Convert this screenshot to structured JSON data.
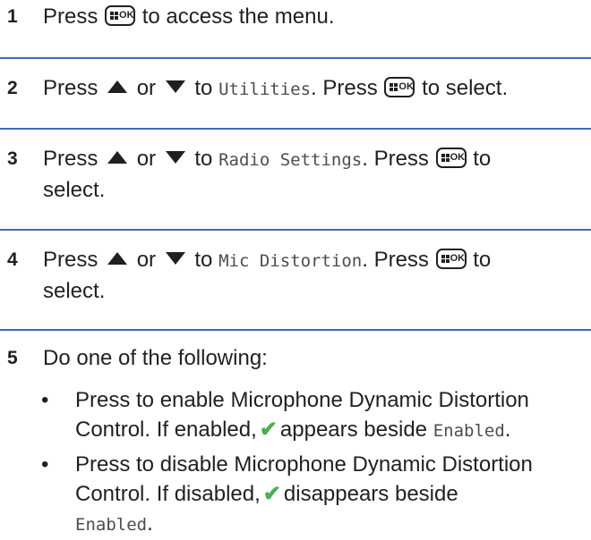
{
  "steps": [
    {
      "num": "1",
      "t1": "Press",
      "t2": "to access the menu."
    },
    {
      "num": "2",
      "t1": "Press",
      "or": "or",
      "to": "to",
      "menu": "Utilities",
      "t3": ". Press",
      "t4": "to select."
    },
    {
      "num": "3",
      "t1": "Press",
      "or": "or",
      "to": "to",
      "menu": "Radio Settings",
      "t3": ". Press",
      "t4": "to",
      "t5": "select."
    },
    {
      "num": "4",
      "t1": "Press",
      "or": "or",
      "to": "to",
      "menu": "Mic Distortion",
      "t3": ". Press",
      "t4": "to",
      "t5": "select."
    },
    {
      "num": "5",
      "text": "Do one of the following:"
    }
  ],
  "bullets": [
    {
      "b": "•",
      "line1": "Press to enable Microphone Dynamic Distortion",
      "line2a": "Control. If enabled,",
      "line2b": "appears beside",
      "word": "Enabled",
      "end": "."
    },
    {
      "b": "•",
      "line1": "Press to disable Microphone Dynamic Distortion",
      "line2a": "Control. If disabled,",
      "line2b": "disappears beside",
      "word": "Enabled",
      "end": "."
    }
  ],
  "icons": {
    "menu_ok_key": "menu-ok-key-icon",
    "up": "up-arrow-icon",
    "down": "down-arrow-icon",
    "check": "checkmark-icon"
  },
  "colors": {
    "separator": "#3a6cb4",
    "check": "#4caf50"
  }
}
